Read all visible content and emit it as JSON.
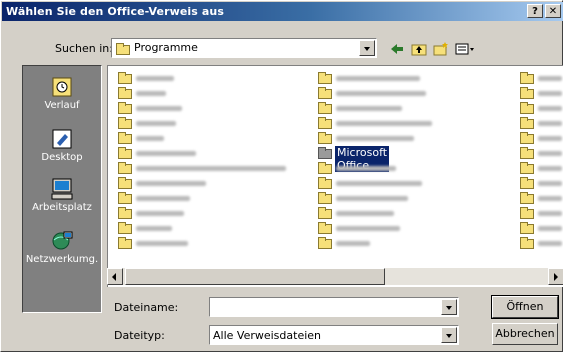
{
  "dialog": {
    "title": "Wählen Sie den Office-Verweis aus",
    "help_button": "?",
    "close_button": "✕"
  },
  "toolbar": {
    "look_in_label": "Suchen in:",
    "look_in_value": "Programme",
    "back_icon": "back-arrow-icon",
    "up_icon": "up-folder-icon",
    "new_folder_icon": "new-folder-icon",
    "views_icon": "views-menu-icon"
  },
  "places": [
    {
      "label": "Verlauf",
      "icon": "history-icon"
    },
    {
      "label": "Desktop",
      "icon": "desktop-icon"
    },
    {
      "label": "Arbeitsplatz",
      "icon": "my-computer-icon"
    },
    {
      "label": "Netzwerkumg.",
      "icon": "network-icon"
    }
  ],
  "files": {
    "selected": "Microsoft Office"
  },
  "bottom": {
    "filename_label": "Dateiname:",
    "filename_value": "",
    "filetype_label": "Dateityp:",
    "filetype_value": "Alle Verweisdateien",
    "open_button": "Öffnen",
    "cancel_button": "Abbrechen"
  },
  "colors": {
    "title_start": "#0a246a",
    "title_end": "#a6caf0",
    "face": "#d4d0c8",
    "selection": "#0a246a"
  }
}
